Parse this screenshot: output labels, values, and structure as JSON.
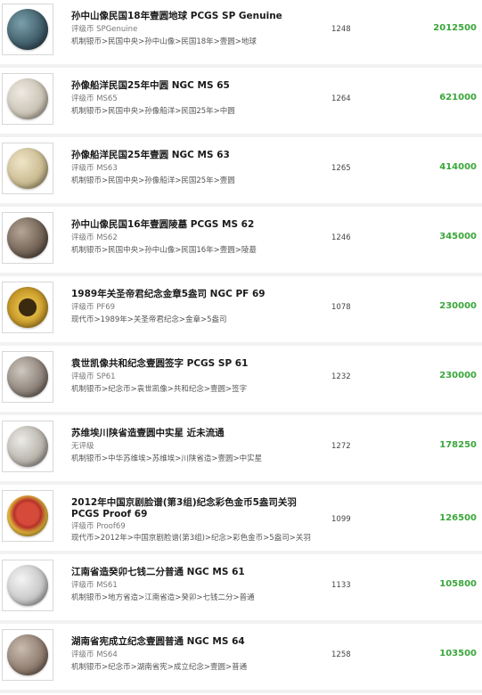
{
  "colors": {
    "price": "#3aa63a",
    "divider": "#f2f2f2"
  },
  "items": [
    {
      "title": "孙中山像民国18年壹圆地球 PCGS SP Genuine",
      "grade": "评级币 SPGenuine",
      "category": "机制银币>民国中央>孙中山像>民国18年>壹圆>地球",
      "lot": "1248",
      "price": "2012500",
      "coin_color": "#3d5a66",
      "icon": "silver-coin-icon"
    },
    {
      "title": "孙像船洋民国25年中圆 NGC MS 65",
      "grade": "评级币 MS65",
      "category": "机制银币>民国中央>孙像船洋>民国25年>中圆",
      "lot": "1264",
      "price": "621000",
      "coin_color": "#c9c2b4",
      "icon": "silver-coin-icon"
    },
    {
      "title": "孙像船洋民国25年壹圆 NGC MS 63",
      "grade": "评级币 MS63",
      "category": "机制银币>民国中央>孙像船洋>民国25年>壹圆",
      "lot": "1265",
      "price": "414000",
      "coin_color": "#c8b98f",
      "icon": "silver-coin-icon"
    },
    {
      "title": "孙中山像民国16年壹圆陵墓 PCGS MS 62",
      "grade": "评级币 MS62",
      "category": "机制银币>民国中央>孙中山像>民国16年>壹圆>陵墓",
      "lot": "1246",
      "price": "345000",
      "coin_color": "#6e5f52",
      "icon": "silver-coin-icon"
    },
    {
      "title": "1989年关圣帝君纪念金章5盎司 NGC PF 69",
      "grade": "评级币 PF69",
      "category": "现代币>1989年>关圣帝君纪念>金章>5盎司",
      "lot": "1078",
      "price": "230000",
      "coin_color": "#c79a2a",
      "icon": "gold-coin-icon"
    },
    {
      "title": "袁世凯像共和纪念壹圆签字 PCGS SP 61",
      "grade": "评级币 SP61",
      "category": "机制银币>纪念币>袁世凯像>共和纪念>壹圆>签字",
      "lot": "1232",
      "price": "230000",
      "coin_color": "#8a7f76",
      "icon": "silver-coin-icon"
    },
    {
      "title": "苏维埃川陕省造壹圆中实星 近未流通",
      "grade": "无评级",
      "category": "机制银币>中华苏维埃>苏维埃>川陕省造>壹圆>中实星",
      "lot": "1272",
      "price": "178250",
      "coin_color": "#b7b2aa",
      "icon": "silver-coin-icon"
    },
    {
      "title": "2012年中国京剧脸谱(第3组)纪念彩色金币5盎司关羽 PCGS Proof 69",
      "grade": "评级币 Proof69",
      "category": "现代币>2012年>中国京剧脸谱(第3组)>纪念>彩色金币>5盎司>关羽",
      "lot": "1099",
      "price": "126500",
      "coin_color": "#b5322a",
      "icon": "gold-coin-icon"
    },
    {
      "title": "江南省造癸卯七钱二分普通 NGC MS 61",
      "grade": "评级币 MS61",
      "category": "机制银币>地方省造>江南省造>癸卯>七钱二分>普通",
      "lot": "1133",
      "price": "105800",
      "coin_color": "#c6c6c6",
      "icon": "silver-coin-icon"
    },
    {
      "title": "湖南省宪成立纪念壹圆普通 NGC MS 64",
      "grade": "评级币 MS64",
      "category": "机制银币>纪念币>湖南省宪>成立纪念>壹圆>普通",
      "lot": "1258",
      "price": "103500",
      "coin_color": "#8d7a6d",
      "icon": "silver-coin-icon"
    }
  ]
}
